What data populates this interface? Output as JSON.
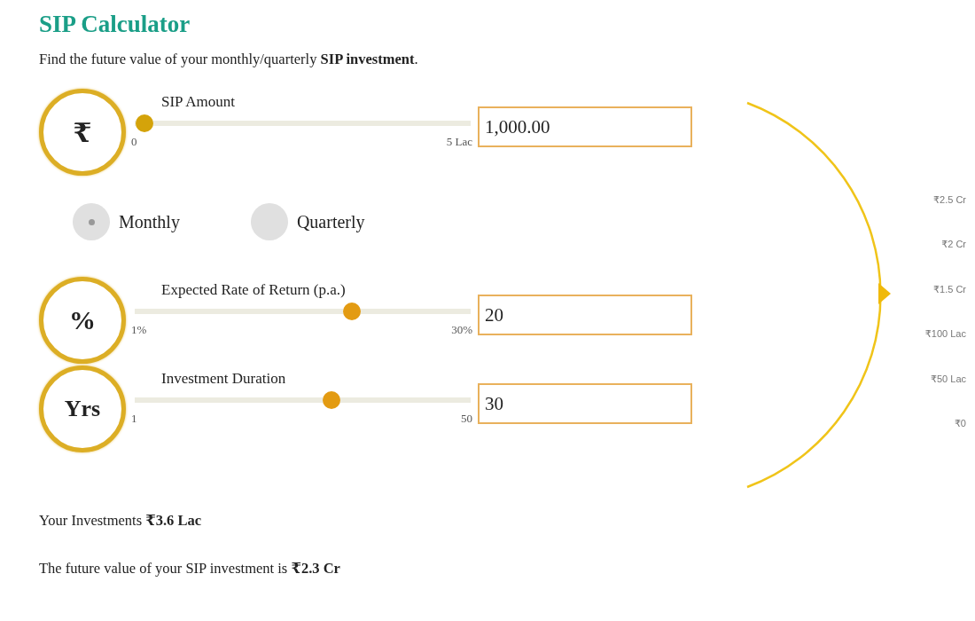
{
  "title": "SIP Calculator",
  "subtitle": "Find the future value of your monthly/quarterly **SIP investment**.",
  "sliders": [
    {
      "kind": "rupee",
      "icon_text": "₹",
      "label": "SIP Amount",
      "min": "0",
      "max": "5 Lac",
      "level": 0.002,
      "value": "1,000.00"
    },
    {
      "kind": "frequency",
      "options": [
        {
          "label": "Monthly",
          "selected": true
        },
        {
          "label": "Quarterly",
          "selected": false
        }
      ]
    },
    {
      "kind": "percent",
      "icon_text": "%",
      "label": "Expected Rate of Return (p.a.)",
      "min": "1%",
      "max": "30%",
      "level": 0.655,
      "value": "20"
    },
    {
      "kind": "years",
      "icon_text": "Yrs",
      "label": "Investment Duration",
      "min": "1",
      "max": "50",
      "level": 0.59,
      "value": "30"
    }
  ],
  "gauge": {
    "scale": [
      "₹2.5 Cr",
      "₹2 Cr",
      "₹1.5 Cr",
      "₹100 Lac",
      "₹50 Lac",
      "₹0"
    ]
  },
  "results": [
    "Your Investments **₹3.6 Lac**",
    "The future value of your SIP investment is **₹2.3 Cr**"
  ]
}
